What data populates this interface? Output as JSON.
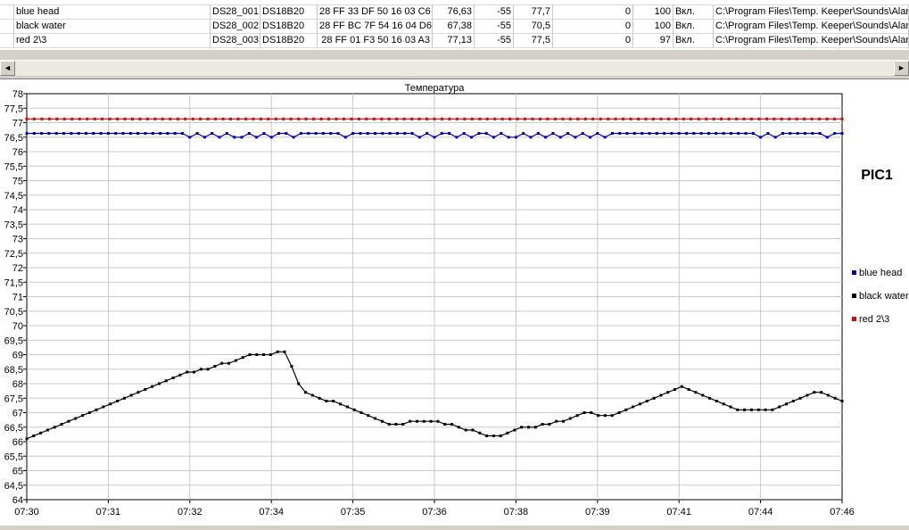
{
  "table": {
    "rows": [
      {
        "name": "blue head",
        "id": "DS28_001",
        "type": "DS18B20",
        "rom": "28 FF 33 DF 50 16 03 C6",
        "value": "76,63",
        "min": "-55",
        "max": "77,7",
        "c8": "0",
        "c9": "100",
        "state": "Вкл.",
        "path": "C:\\Program Files\\Temp. Keeper\\Sounds\\Alarm"
      },
      {
        "name": "black water",
        "id": "DS28_002",
        "type": "DS18B20",
        "rom": "28 FF BC 7F 54 16 04 D6",
        "value": "67,38",
        "min": "-55",
        "max": "70,5",
        "c8": "0",
        "c9": "100",
        "state": "Вкл.",
        "path": "C:\\Program Files\\Temp. Keeper\\Sounds\\Alarm"
      },
      {
        "name": "red 2\\3",
        "id": "DS28_003",
        "type": "DS18B20",
        "rom": "28 FF 01 F3 50 16 03 A3",
        "value": "77,13",
        "min": "-55",
        "max": "77,5",
        "c8": "0",
        "c9": "97",
        "state": "Вкл.",
        "path": "C:\\Program Files\\Temp. Keeper\\Sounds\\Alarm"
      }
    ]
  },
  "scrollbar": {
    "left_arrow": "◄",
    "right_arrow": "►"
  },
  "chart_data": {
    "type": "line",
    "title": "Температура",
    "subtitle": "PIC1",
    "ylim": [
      64,
      78
    ],
    "yticks": [
      "64",
      "64,5",
      "65",
      "65,5",
      "66",
      "66,5",
      "67",
      "67,5",
      "68",
      "68,5",
      "69",
      "69,5",
      "70",
      "70,5",
      "71",
      "71,5",
      "72",
      "72,5",
      "73",
      "73,5",
      "74",
      "74,5",
      "75",
      "75,5",
      "76",
      "76,5",
      "77",
      "77,5",
      "78"
    ],
    "xticks": [
      "07:30",
      "07:31",
      "07:32",
      "07:34",
      "07:35",
      "07:36",
      "07:38",
      "07:39",
      "07:41",
      "07:44",
      "07:46"
    ],
    "series": [
      {
        "name": "blue head",
        "color": "#0000cc",
        "values": [
          76.63,
          76.63,
          76.63,
          76.63,
          76.63,
          76.63,
          76.63,
          76.63,
          76.63,
          76.63,
          76.63,
          76.63,
          76.63,
          76.63,
          76.63,
          76.63,
          76.63,
          76.63,
          76.63,
          76.63,
          76.63,
          76.63,
          76.5,
          76.63,
          76.5,
          76.63,
          76.5,
          76.63,
          76.5,
          76.5,
          76.63,
          76.5,
          76.63,
          76.5,
          76.63,
          76.63,
          76.5,
          76.63,
          76.63,
          76.63,
          76.63,
          76.63,
          76.63,
          76.5,
          76.63,
          76.63,
          76.63,
          76.63,
          76.63,
          76.63,
          76.63,
          76.63,
          76.63,
          76.5,
          76.63,
          76.5,
          76.63,
          76.63,
          76.5,
          76.63,
          76.5,
          76.63,
          76.63,
          76.5,
          76.63,
          76.5,
          76.5,
          76.63,
          76.5,
          76.63,
          76.5,
          76.63,
          76.5,
          76.63,
          76.5,
          76.63,
          76.5,
          76.63,
          76.5,
          76.63,
          76.63,
          76.63,
          76.63,
          76.63,
          76.63,
          76.63,
          76.63,
          76.63,
          76.63,
          76.63,
          76.63,
          76.63,
          76.63,
          76.63,
          76.63,
          76.63,
          76.63,
          76.63,
          76.63,
          76.5,
          76.63,
          76.5,
          76.63,
          76.63,
          76.63,
          76.63,
          76.63,
          76.63,
          76.5,
          76.63,
          76.63
        ]
      },
      {
        "name": "black water",
        "color": "#000000",
        "values": [
          66.1,
          66.2,
          66.3,
          66.4,
          66.5,
          66.6,
          66.7,
          66.8,
          66.9,
          67,
          67.1,
          67.2,
          67.3,
          67.4,
          67.5,
          67.6,
          67.7,
          67.8,
          67.9,
          68,
          68.1,
          68.2,
          68.3,
          68.4,
          68.4,
          68.5,
          68.5,
          68.6,
          68.7,
          68.7,
          68.8,
          68.9,
          69,
          69,
          69,
          69,
          69.1,
          69.1,
          68.6,
          68,
          67.7,
          67.6,
          67.5,
          67.4,
          67.4,
          67.3,
          67.2,
          67.1,
          67,
          66.9,
          66.8,
          66.7,
          66.6,
          66.6,
          66.6,
          66.7,
          66.7,
          66.7,
          66.7,
          66.7,
          66.6,
          66.6,
          66.5,
          66.4,
          66.4,
          66.3,
          66.2,
          66.2,
          66.2,
          66.3,
          66.4,
          66.5,
          66.5,
          66.5,
          66.6,
          66.6,
          66.7,
          66.7,
          66.8,
          66.9,
          67,
          67,
          66.9,
          66.9,
          66.9,
          67,
          67.1,
          67.2,
          67.3,
          67.4,
          67.5,
          67.6,
          67.7,
          67.8,
          67.9,
          67.8,
          67.7,
          67.6,
          67.5,
          67.4,
          67.3,
          67.2,
          67.1,
          67.1,
          67.1,
          67.1,
          67.1,
          67.1,
          67.2,
          67.3,
          67.4,
          67.5,
          67.6,
          67.7,
          67.7,
          67.6,
          67.5,
          67.4
        ]
      },
      {
        "name": "red 2\\3",
        "color": "#e00000",
        "values": [
          77.13,
          77.13,
          77.13,
          77.13,
          77.13,
          77.13,
          77.13,
          77.13,
          77.13,
          77.13,
          77.13,
          77.13,
          77.13,
          77.13,
          77.13,
          77.13,
          77.13,
          77.13,
          77.13,
          77.13,
          77.13,
          77.13,
          77.13,
          77.13,
          77.13,
          77.13,
          77.13,
          77.13,
          77.13,
          77.13,
          77.13,
          77.13,
          77.13,
          77.13,
          77.13,
          77.13,
          77.13,
          77.13,
          77.13,
          77.13,
          77.13,
          77.13,
          77.13,
          77.13,
          77.13,
          77.13,
          77.13,
          77.13,
          77.13,
          77.13,
          77.13,
          77.13,
          77.13,
          77.13,
          77.13,
          77.13,
          77.13,
          77.13,
          77.13,
          77.13,
          77.13,
          77.13,
          77.13,
          77.13,
          77.13,
          77.13,
          77.13,
          77.13,
          77.13,
          77.13,
          77.13,
          77.13,
          77.13,
          77.13,
          77.13,
          77.13,
          77.13,
          77.13,
          77.13,
          77.13,
          77.13,
          77.13,
          77.13,
          77.13,
          77.13,
          77.13,
          77.13,
          77.13,
          77.13,
          77.13,
          77.13,
          77.13,
          77.13,
          77.13,
          77.13,
          77.13,
          77.13,
          77.13,
          77.13,
          77.13,
          77.13,
          77.13,
          77.13,
          77.13,
          77.13,
          77.13,
          77.13,
          77.13,
          77.13
        ]
      }
    ],
    "legend": "right",
    "grid": true
  }
}
